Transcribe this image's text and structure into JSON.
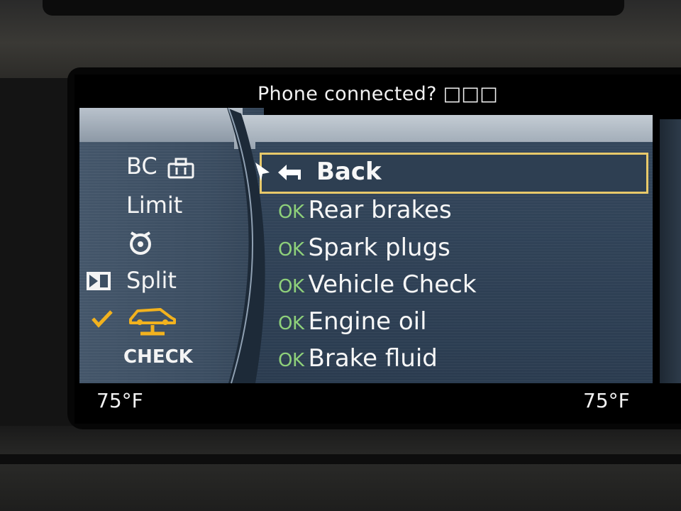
{
  "status_bar": {
    "text": "Phone connected? □□□"
  },
  "left_menu": {
    "items": [
      {
        "label": "BC",
        "icon": "briefcase-icon"
      },
      {
        "label": "Limit"
      },
      {
        "icon": "stopwatch-icon"
      },
      {
        "label": "Split",
        "icon": "split-screen-icon"
      },
      {
        "icon": "car-on-lift-icon",
        "selected": true
      },
      {
        "label": "CHECK"
      }
    ]
  },
  "main_menu": {
    "back_label": "Back",
    "items": [
      {
        "status": "OK",
        "label": "Rear brakes"
      },
      {
        "status": "OK",
        "label": "Spark plugs"
      },
      {
        "status": "OK",
        "label": "Vehicle Check"
      },
      {
        "status": "OK",
        "label": "Engine oil"
      },
      {
        "status": "OK",
        "label": "Brake fluid"
      }
    ]
  },
  "footer": {
    "temp_left": "75°F",
    "temp_right": "75°F"
  },
  "colors": {
    "highlight": "#e8c96a",
    "ok_green": "#8ed07a",
    "selected_icon": "#f2b21e"
  }
}
